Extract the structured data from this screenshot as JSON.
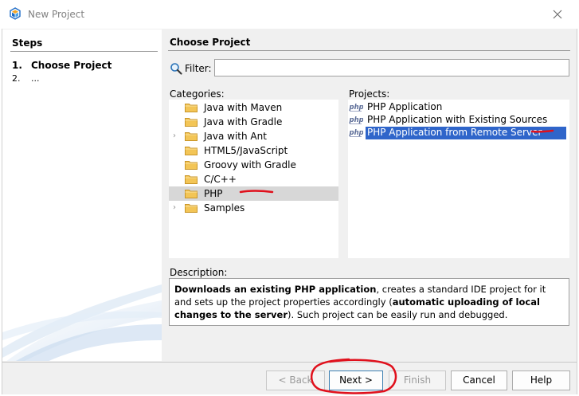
{
  "window": {
    "title": "New Project"
  },
  "steps": {
    "title": "Steps",
    "items": [
      {
        "num": "1.",
        "label": "Choose Project"
      },
      {
        "num": "2.",
        "label": "..."
      }
    ]
  },
  "main": {
    "title": "Choose Project",
    "filter": {
      "label": "Filter:",
      "value": ""
    },
    "categories_label": "Categories:",
    "projects_label": "Projects:",
    "categories": [
      {
        "label": "Java with Maven",
        "expandable": false
      },
      {
        "label": "Java with Gradle",
        "expandable": false
      },
      {
        "label": "Java with Ant",
        "expandable": true
      },
      {
        "label": "HTML5/JavaScript",
        "expandable": false
      },
      {
        "label": "Groovy with Gradle",
        "expandable": false
      },
      {
        "label": "C/C++",
        "expandable": false
      },
      {
        "label": "PHP",
        "expandable": false,
        "selected": true
      },
      {
        "label": "Samples",
        "expandable": true
      }
    ],
    "projects": [
      {
        "label": "PHP Application"
      },
      {
        "label": "PHP Application with Existing Sources"
      },
      {
        "label": "PHP Application from Remote Server",
        "selected": true
      }
    ],
    "description": {
      "label": "Description:",
      "bold1": "Downloads an existing PHP application",
      "text1": ", creates a standard IDE project for it and sets up the project properties accordingly (",
      "bold2": "automatic uploading of local changes to the server",
      "text2": "). Such project can be easily run and debugged."
    }
  },
  "buttons": {
    "back": "< Back",
    "next": "Next >",
    "finish": "Finish",
    "cancel": "Cancel",
    "help": "Help"
  },
  "colors": {
    "selection": "#2f65ca",
    "annotation": "#e0101c",
    "folder": "#f3c556"
  }
}
